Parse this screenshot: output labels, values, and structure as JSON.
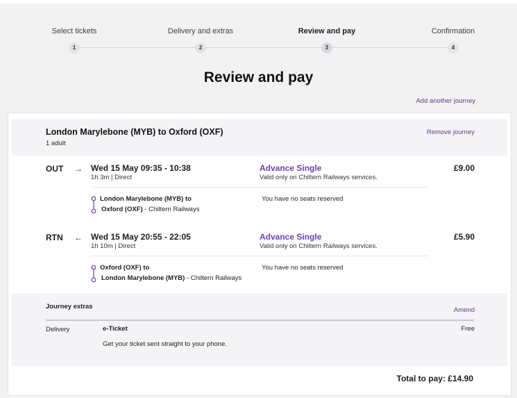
{
  "stepper": {
    "steps": [
      {
        "label": "Select tickets",
        "number": "1"
      },
      {
        "label": "Delivery and extras",
        "number": "2"
      },
      {
        "label": "Review and pay",
        "number": "3"
      },
      {
        "label": "Confirmation",
        "number": "4"
      }
    ],
    "active_step": 3
  },
  "page_title": "Review and pay",
  "add_journey_label": "Add another journey",
  "journey": {
    "title": "London Marylebone (MYB) to Oxford (OXF)",
    "passengers": "1 adult",
    "remove_label": "Remove journey",
    "legs": [
      {
        "direction": "OUT",
        "arrow": "→",
        "times": "Wed 15 May 09:35 - 10:38",
        "duration": "1h 3m | Direct",
        "fare_name": "Advance Single",
        "fare_note": "Valid only on Chiltern Railways services.",
        "price": "£9.00",
        "from": "London Marylebone (MYB) to",
        "to_station": "Oxford (OXF)",
        "to_operator": " - Chiltern Railways",
        "seats": "You have no seats reserved"
      },
      {
        "direction": "RTN",
        "arrow": "←",
        "times": "Wed 15 May 20:55 - 22:05",
        "duration": "1h 10m | Direct",
        "fare_name": "Advance Single",
        "fare_note": "Valid only on Chiltern Railways services.",
        "price": "£5.90",
        "from": "Oxford (OXF) to",
        "to_station": "London Marylebone (MYB)",
        "to_operator": " - Chiltern Railways",
        "seats": "You have no seats reserved"
      }
    ]
  },
  "extras": {
    "title": "Journey extras",
    "amend_label": "Amend",
    "delivery_label": "Delivery",
    "ticket_type": "e-Ticket",
    "ticket_desc": "Get your ticket sent straight to your phone.",
    "price": "Free"
  },
  "total": "Total to pay: £14.90",
  "colors": {
    "accent": "#6b40a8",
    "link": "#5c3b8c",
    "background": "#f2f2f3"
  }
}
